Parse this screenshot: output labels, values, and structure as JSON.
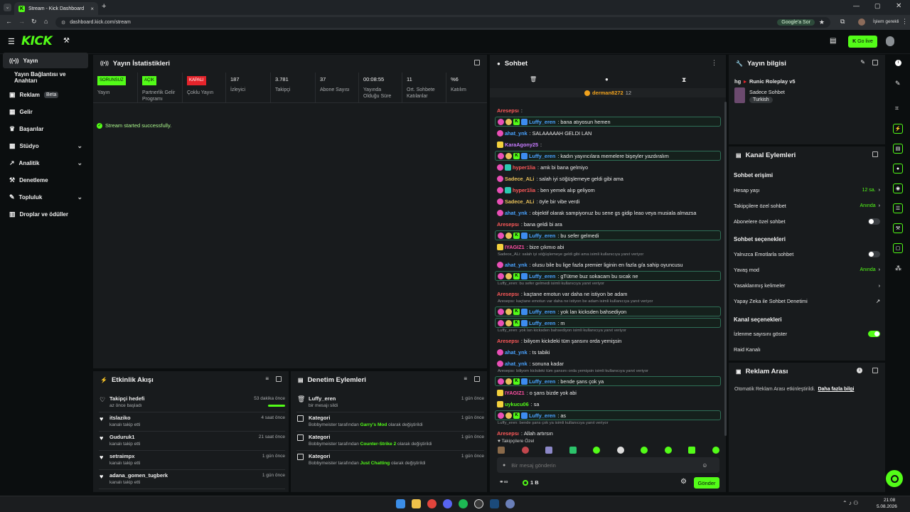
{
  "browser": {
    "tab_title": "Stream - Kick Dashboard",
    "new_tab": "+",
    "url": "dashboard.kick.com/stream",
    "google_chip": "Google'a Sor",
    "profile_label": "İşlem gerekli"
  },
  "topbar": {
    "logo": "KICK",
    "go_live": "Go live"
  },
  "sidebar": {
    "items": [
      {
        "label": "Yayın",
        "icon": "stream-icon"
      },
      {
        "label": "Yayın Bağlantısı ve Anahtarı",
        "icon": "key-icon"
      },
      {
        "label": "Reklam",
        "badge": "Beta",
        "icon": "ad-icon"
      },
      {
        "label": "Gelir",
        "icon": "money-icon"
      },
      {
        "label": "Başarılar",
        "icon": "trophy-icon"
      },
      {
        "label": "Stüdyo",
        "icon": "studio-icon"
      },
      {
        "label": "Analitik",
        "icon": "analytics-icon"
      },
      {
        "label": "Denetleme",
        "icon": "hammer-icon"
      },
      {
        "label": "Topluluk",
        "icon": "community-icon"
      },
      {
        "label": "Droplar ve ödüller",
        "icon": "gift-icon"
      }
    ]
  },
  "stats_panel": {
    "title": "Yayın İstatistikleri",
    "success_msg": "Stream started successfully.",
    "stats": [
      {
        "tag": "SORUNSUZ",
        "label": "Yayın",
        "tag_color": "#53fc18"
      },
      {
        "tag": "AÇIK",
        "label": "Partnerlik Gelir Programı",
        "tag_color": "#53fc18"
      },
      {
        "tag": "KAPALI",
        "label": "Çoklu Yayın",
        "tag_color": "#e5242b"
      },
      {
        "value": "187",
        "label": "İzleyici"
      },
      {
        "value": "3.781",
        "label": "Takipçi"
      },
      {
        "value": "37",
        "label": "Abone Sayısı"
      },
      {
        "value": "00:08:55",
        "label": "Yayında Olduğu Süre"
      },
      {
        "value": "11",
        "label": "Ort. Sohbete Katılanlar"
      },
      {
        "value": "%6",
        "label": "Katılım"
      }
    ]
  },
  "activity_feed": {
    "title": "Etkinlik Akışı",
    "items": [
      {
        "name": "Takipçi hedefi",
        "sub": "az önce başladı",
        "time": "53 dakika önce",
        "progress": 1.0
      },
      {
        "name": "itslaziko",
        "sub": "kanalı takip etti",
        "time": "4 saat önce"
      },
      {
        "name": "Guduruk1",
        "sub": "kanalı takip etti",
        "time": "21 saat önce"
      },
      {
        "name": "setraimpx",
        "sub": "kanalı takip etti",
        "time": "1 gün önce"
      },
      {
        "name": "adana_gomen_tugberk",
        "sub": "kanalı takip etti",
        "time": "1 gün önce"
      }
    ]
  },
  "mod_actions": {
    "title": "Denetim Eylemleri",
    "items": [
      {
        "name": "Luffy_eren",
        "pre": "bir mesajı sildi",
        "hl": "",
        "post": "",
        "time": "1 gün önce"
      },
      {
        "name": "Kategori",
        "pre": "Bobbymeister tarafından",
        "hl": "Garry's Mod",
        "post": "olarak değiştirildi",
        "time": "1 gün önce"
      },
      {
        "name": "Kategori",
        "pre": "Bobbymeister tarafından",
        "hl": "Counter-Strike 2",
        "post": "olarak değiştirildi",
        "time": "1 gün önce"
      },
      {
        "name": "Kategori",
        "pre": "Bobbymeister tarafından",
        "hl": "Just Chatting",
        "post": "olarak değiştirildi",
        "time": "1 gün önce"
      }
    ]
  },
  "chat": {
    "title": "Sohbet",
    "pinned_user": "derman8272",
    "pinned_count": "12",
    "messages": [
      {
        "user": "Aresepsı",
        "color": "#ff5a5a",
        "text": "",
        "badges": ""
      },
      {
        "user": "Luffy_eren",
        "color": "#4aa3ff",
        "text": "bana atıyosun hemen",
        "badges": "pgkb",
        "hl": true
      },
      {
        "user": "ahat_ynk",
        "color": "#4aa3ff",
        "text": "SALAAAAAH GELDI LAN",
        "badges": "p"
      },
      {
        "user": "KaraAgony25",
        "color": "#c77bff",
        "text": "",
        "badges": "y"
      },
      {
        "user": "Luffy_eren",
        "color": "#4aa3ff",
        "text": "kadın yayıncılara memelere bişeyler yazdıralım",
        "badges": "pgkb",
        "hl": true
      },
      {
        "user": "hyper1lia",
        "color": "#ff5a5a",
        "text": "amk bi bana gelmiyo",
        "badges": "pt"
      },
      {
        "user": "Sadece_ALi",
        "color": "#e8c05a",
        "text": "salah iyi söğüşlemeye geldi gibi ama",
        "badges": "p"
      },
      {
        "user": "hyper1lia",
        "color": "#ff5a5a",
        "text": "ben yemek alıp geliyom",
        "badges": "pt"
      },
      {
        "user": "Sadece_ALi",
        "color": "#e8c05a",
        "text": "öyle bir vibe verdi",
        "badges": "p"
      },
      {
        "user": "ahat_ynk",
        "color": "#4aa3ff",
        "text": "objektif olarak sampiyonuz bu sene gs gidip leao veya musiala almazsa",
        "badges": "p"
      },
      {
        "user": "Aresepsı",
        "color": "#ff5a5a",
        "text": "bana geldi bi ara",
        "badges": ""
      },
      {
        "user": "Luffy_eren",
        "color": "#4aa3ff",
        "text": "bu sefer gelmedi",
        "badges": "pgkb",
        "hl": true
      },
      {
        "user": "IYAGIZ1",
        "color": "#ff4fa3",
        "text": "bize çıkmıo abi",
        "badges": "y"
      },
      {
        "reply": "Sadece_ALi: salah iyi söğüşlemeye geldi gibi ama isimli kullanıcıya yanıt veriyor"
      },
      {
        "user": "ahat_ynk",
        "color": "#4aa3ff",
        "text": "olusu bile bu lige fazla premier liginin en fazla g/a sahip oyuncusu",
        "badges": "p"
      },
      {
        "user": "Luffy_eren",
        "color": "#4aa3ff",
        "text": "gTütme buz sokacam bu sıcak ne",
        "badges": "pgkb",
        "hl": true
      },
      {
        "reply": "Luffy_eren: bu sefer gelmedi isimli kullanıcıya yanıt veriyor"
      },
      {
        "user": "Aresepsı",
        "color": "#ff5a5a",
        "text": "kaçtane emotun var daha ne istiyon be adam",
        "badges": ""
      },
      {
        "reply": "Aresepsı: kaçtane emotun var daha ne istiyon be adam isimli kullanıcıya yanıt veriyor"
      },
      {
        "user": "Luffy_eren",
        "color": "#4aa3ff",
        "text": "yok lan kicksden bahsediyon",
        "badges": "pgkb",
        "hl": true
      },
      {
        "user": "Luffy_eren",
        "color": "#4aa3ff",
        "text": "m",
        "badges": "pgkb",
        "hl": true
      },
      {
        "reply": "Luffy_eren: yok lan kicksden bahsediyon isimli kullanıcıya yanıt veriyor"
      },
      {
        "user": "Aresepsı",
        "color": "#ff5a5a",
        "text": "biliyom kickdeki tüm şansını orda yemişsin",
        "badges": ""
      },
      {
        "user": "ahat_ynk",
        "color": "#4aa3ff",
        "text": "ts tabiki",
        "badges": "p"
      },
      {
        "user": "ahat_ynk",
        "color": "#4aa3ff",
        "text": "sonuna kadar",
        "badges": "p"
      },
      {
        "reply": "Aresepsı: biliyom kickdeki tüm şansını orda yemişsin isimli kullanıcıya yanıt veriyor"
      },
      {
        "user": "Luffy_eren",
        "color": "#4aa3ff",
        "text": "bende şans çok ya",
        "badges": "pgkb",
        "hl": true
      },
      {
        "user": "IYAGIZ1",
        "color": "#ff4fa3",
        "text": "o şans bizde yok abi",
        "badges": "y"
      },
      {
        "user": "uykucu06",
        "color": "#53fc18",
        "text": "sa",
        "badges": "y"
      },
      {
        "user": "Luffy_eren",
        "color": "#4aa3ff",
        "text": "as",
        "badges": "pgkb",
        "hl": true
      },
      {
        "reply": "Luffy_eren: bende şans çok ya isimli kullanıcıya yanıt veriyor"
      },
      {
        "user": "Aresepsı",
        "color": "#ff5a5a",
        "text": "Allah artırsın",
        "badges": ""
      }
    ],
    "emote_label": "Takipçilere Özel",
    "input_placeholder": "Bir mesaj gönderin",
    "points": "1 B",
    "send": "Gönder"
  },
  "stream_info": {
    "title": "Yayın bilgisi",
    "stream_title": "hg",
    "category": "Runic Roleplay v5",
    "channel": "Sadece Sohbet",
    "language": "Turkish"
  },
  "channel_actions": {
    "title": "Kanal Eylemleri",
    "chat_access": "Sohbet erişimi",
    "account_age": "Hesap yaşı",
    "account_age_val": "12 sa.",
    "followers_only": "Takipçilere özel sohbet",
    "followers_only_val": "Anında",
    "subs_only": "Abonelere özel sohbet",
    "chat_options": "Sohbet seçenekleri",
    "emote_only": "Yalnızca Emotlarla sohbet",
    "slow_mode": "Yavaş mod",
    "slow_mode_val": "Anında",
    "banned_words": "Yasaklanmış kelimeler",
    "ai_mod": "Yapay Zeka ile Sohbet Denetimi",
    "channel_options": "Kanal seçenekleri",
    "show_viewers": "İzlenme sayısını göster",
    "raid": "Raid Kanalı"
  },
  "ad_break": {
    "title": "Reklam Arası",
    "text": "Otomatik Reklam Arası etkinleştirildi.",
    "link": "Daha fazla bilgi"
  },
  "taskbar": {
    "time": "21:08",
    "date": "5.08.2026"
  },
  "colors": {
    "accent": "#53fc18",
    "panel": "#181b1d",
    "bg": "#0b0e0f"
  }
}
